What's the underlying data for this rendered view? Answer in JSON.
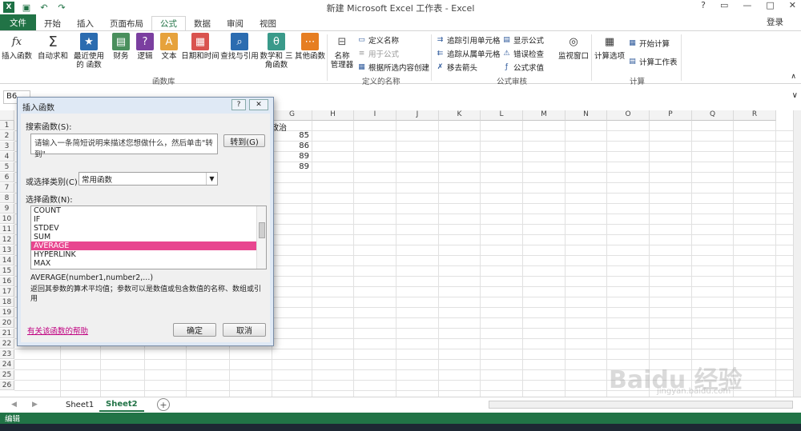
{
  "window": {
    "title": "新建 Microsoft Excel 工作表 - Excel",
    "help": "?",
    "min": "—",
    "max": "□",
    "close": "✕",
    "login": "登录"
  },
  "tabs": [
    "文件",
    "开始",
    "插入",
    "页面布局",
    "公式",
    "数据",
    "审阅",
    "视图"
  ],
  "ribbon": {
    "function_library": {
      "label": "函数库",
      "items": [
        "插入函数",
        "自动求和",
        "最近使用的 函数",
        "财务",
        "逻辑",
        "文本",
        "日期和时间",
        "查找与引用",
        "数学和 三角函数",
        "其他函数"
      ]
    },
    "defined_names": {
      "label": "定义的名称",
      "manager": "名称 管理器",
      "define": "定义名称",
      "use_in_formula": "用于公式",
      "create_from_selection": "根据所选内容创建"
    },
    "formula_auditing": {
      "label": "公式审核",
      "trace_precedents": "追踪引用单元格",
      "trace_dependents": "追踪从属单元格",
      "remove_arrows": "移去箭头",
      "show_formulas": "显示公式",
      "error_checking": "错误检查",
      "evaluate": "公式求值",
      "watch": "监视窗口"
    },
    "calculation": {
      "label": "计算",
      "options": "计算选项",
      "calc_now": "开始计算",
      "calc_sheet": "计算工作表"
    }
  },
  "formula_bar": {
    "name_box": "B6"
  },
  "grid": {
    "columns": [
      "G",
      "H",
      "I",
      "J",
      "K",
      "L",
      "M",
      "N",
      "O",
      "P",
      "Q",
      "R"
    ],
    "rows": [
      "1",
      "2",
      "3",
      "4",
      "5",
      "6",
      "7",
      "8",
      "9",
      "10",
      "11",
      "12",
      "13",
      "14",
      "15",
      "16",
      "17",
      "18",
      "19",
      "20",
      "21",
      "22",
      "23",
      "24",
      "25",
      "26"
    ],
    "header_text": "政治",
    "values": [
      "85",
      "86",
      "89",
      "89"
    ]
  },
  "sheets": [
    "Sheet1",
    "Sheet2"
  ],
  "status": "编辑",
  "dialog": {
    "title": "插入函数",
    "search_label": "搜索函数(S):",
    "search_value": "请输入一条简短说明来描述您想做什么，然后单击\"转到\"",
    "go_button": "转到(G)",
    "category_label": "或选择类别(C):",
    "category_value": "常用函数",
    "select_label": "选择函数(N):",
    "functions": [
      "COUNT",
      "IF",
      "STDEV",
      "SUM",
      "AVERAGE",
      "HYPERLINK",
      "MAX"
    ],
    "selected": "AVERAGE",
    "syntax": "AVERAGE(number1,number2,...)",
    "description": "返回其参数的算术平均值；参数可以是数值或包含数值的名称、数组或引用",
    "help_link": "有关该函数的帮助",
    "ok": "确定",
    "cancel": "取消"
  },
  "watermark": {
    "brand": "Baidu 经验",
    "url": "jingyan.baidu.com"
  }
}
